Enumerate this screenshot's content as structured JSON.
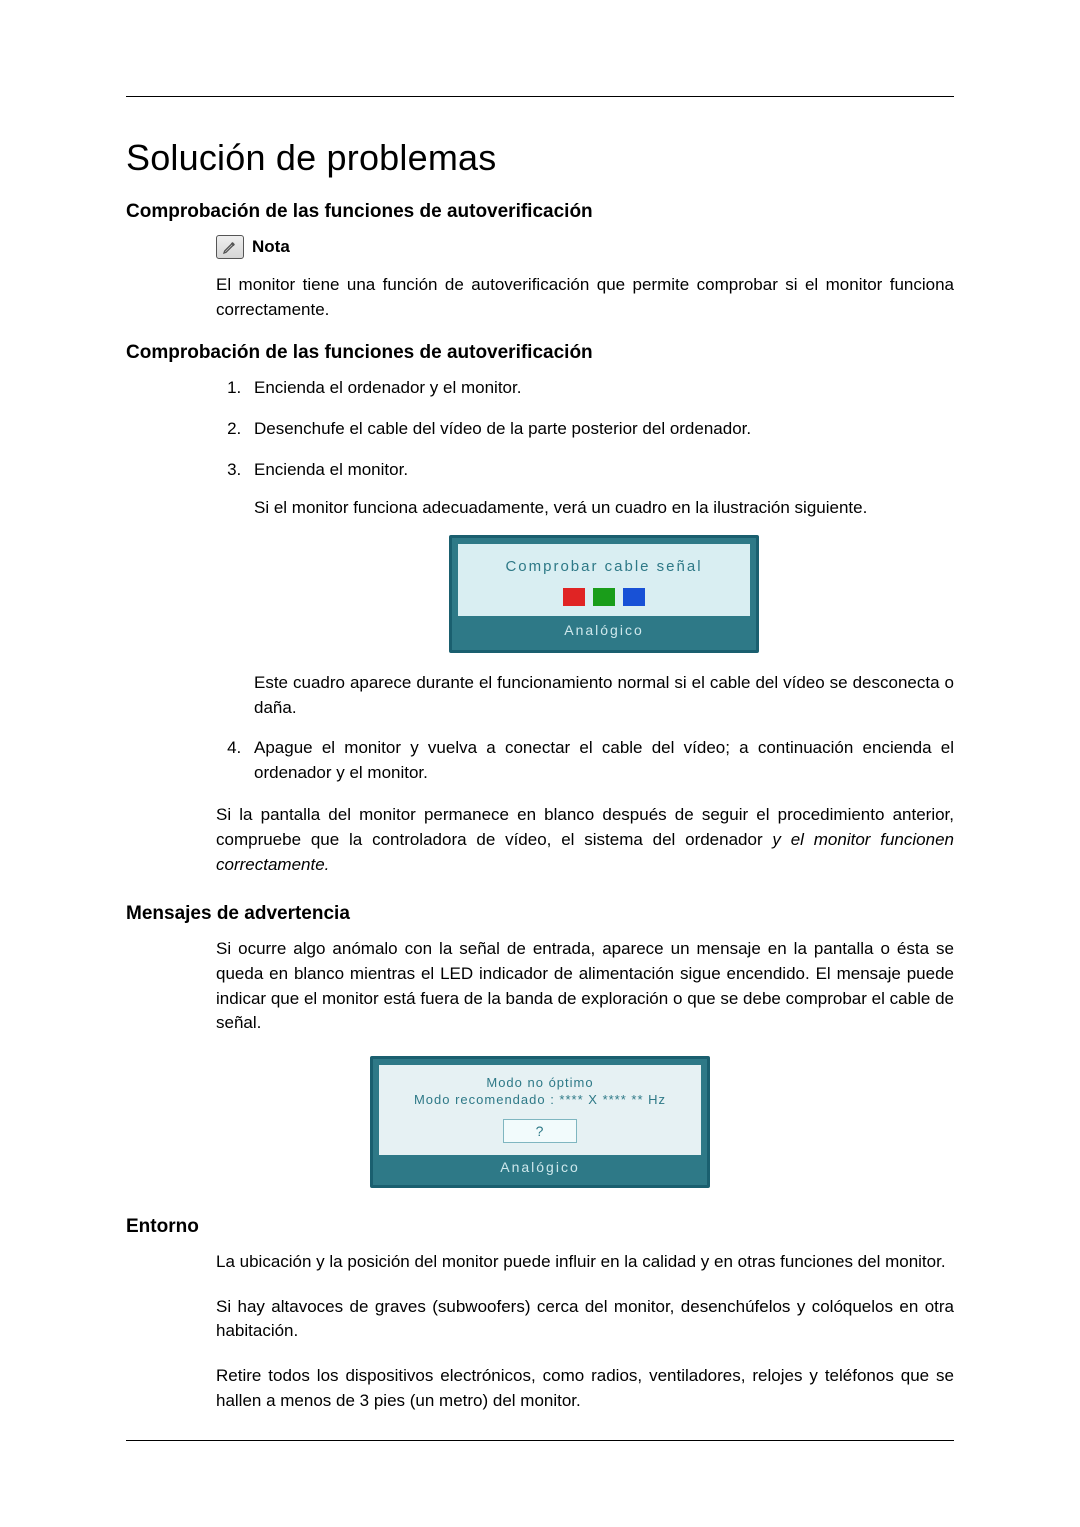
{
  "title": "Solución de problemas",
  "section1": {
    "heading": "Comprobación de las funciones de autoverificación",
    "note_label": "Nota",
    "note_body": "El monitor tiene una función de autoverificación que permite comprobar si el monitor funciona correctamente."
  },
  "section2": {
    "heading": "Comprobación de las funciones de autoverificación",
    "steps": {
      "s1": "Encienda el ordenador y el monitor.",
      "s2": "Desenchufe el cable del vídeo de la parte posterior del ordenador.",
      "s3a": "Encienda el monitor.",
      "s3b": "Si el monitor funciona adecuadamente, verá un cuadro en la ilustración siguiente.",
      "s3_after": "Este cuadro aparece durante el funcionamiento normal si el cable del vídeo se desconecta o daña.",
      "s4": "Apague el monitor y vuelva a conectar el cable del vídeo; a continuación encienda el ordenador y el monitor."
    },
    "monitor1": {
      "message": "Comprobar cable señal",
      "footer": "Analógico"
    },
    "after_plain": "Si la pantalla del monitor permanece en blanco después de seguir el procedimiento anterior, compruebe que la controladora de vídeo, el sistema del ordenador ",
    "after_italic": "y el monitor funcionen correctamente."
  },
  "section3": {
    "heading": "Mensajes de advertencia",
    "body": "Si ocurre algo anómalo con la señal de entrada, aparece un mensaje en la pantalla o ésta se queda en blanco mientras el LED indicador de alimentación sigue encendido. El mensaje puede indicar que el monitor está fuera de la banda de exploración o que se debe comprobar el cable de señal.",
    "monitor2": {
      "line1": "Modo no óptimo",
      "line2": "Modo recomendado :  **** X **** ** Hz",
      "button": "?",
      "footer": "Analógico"
    }
  },
  "section4": {
    "heading": "Entorno",
    "p1": "La ubicación y la posición del monitor puede influir en la calidad y en otras funciones del monitor.",
    "p2": "Si hay altavoces de graves (subwoofers) cerca del monitor, desenchúfelos y colóquelos en otra habitación.",
    "p3": "Retire todos los dispositivos electrónicos, como radios, ventiladores, relojes y teléfonos que se hallen a menos de 3 pies (un metro) del monitor."
  }
}
